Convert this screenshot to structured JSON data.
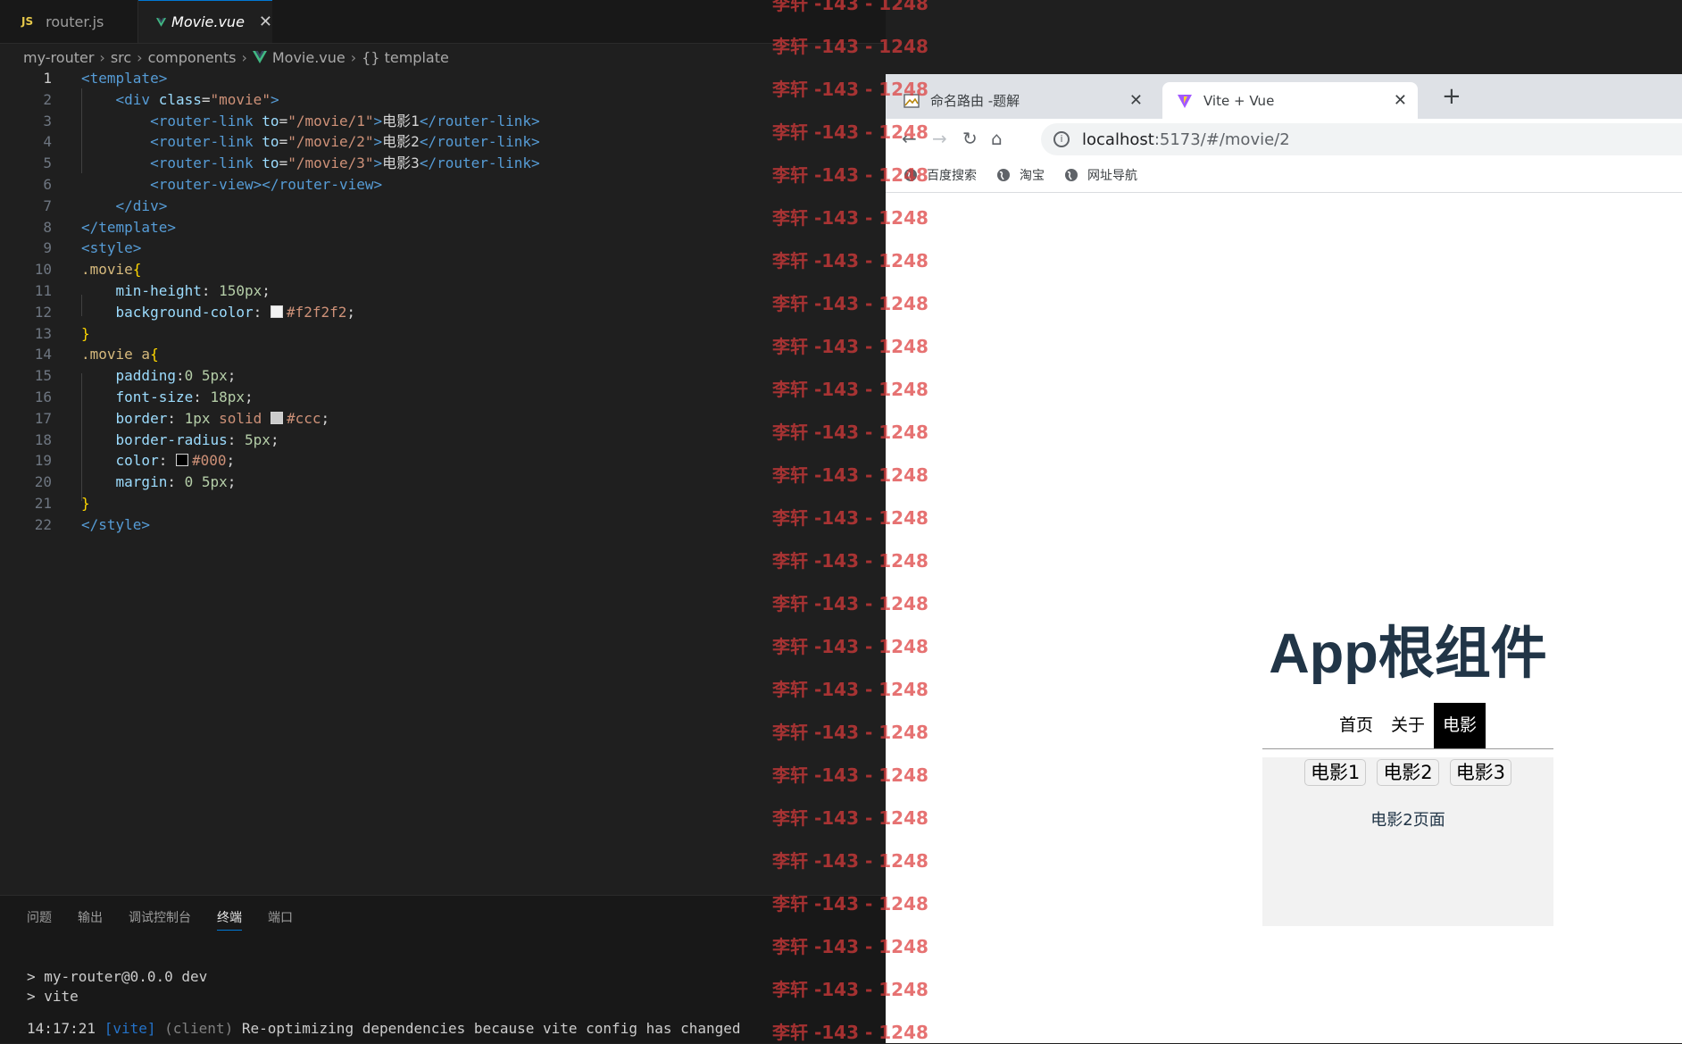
{
  "editor": {
    "tabs": [
      {
        "icon": "JS",
        "label": "router.js"
      },
      {
        "label": "Movie.vue"
      }
    ],
    "breadcrumb": [
      "my-router",
      "src",
      "components",
      "Movie.vue",
      "{} template"
    ],
    "lines": [
      {
        "n": "1",
        "html": "<span class=\"tag\">&lt;template&gt;</span>"
      },
      {
        "n": "2",
        "html": "    <span class=\"tag\">&lt;div</span> <span class=\"attr\">class</span>=<span class=\"str\">\"movie\"</span><span class=\"tag\">&gt;</span>"
      },
      {
        "n": "3",
        "html": "        <span class=\"tag\">&lt;router-link</span> <span class=\"attr\">to</span>=<span class=\"str\">\"/movie/1\"</span><span class=\"tag\">&gt;</span>电影1<span class=\"tag\">&lt;/router-link&gt;</span>"
      },
      {
        "n": "4",
        "html": "        <span class=\"tag\">&lt;router-link</span> <span class=\"attr\">to</span>=<span class=\"str\">\"/movie/2\"</span><span class=\"tag\">&gt;</span>电影2<span class=\"tag\">&lt;/router-link&gt;</span>"
      },
      {
        "n": "5",
        "html": "        <span class=\"tag\">&lt;router-link</span> <span class=\"attr\">to</span>=<span class=\"str\">\"/movie/3\"</span><span class=\"tag\">&gt;</span>电影3<span class=\"tag\">&lt;/router-link&gt;</span>"
      },
      {
        "n": "6",
        "html": "        <span class=\"tag\">&lt;router-view&gt;&lt;/router-view&gt;</span>"
      },
      {
        "n": "7",
        "html": "    <span class=\"tag\">&lt;/div&gt;</span>"
      },
      {
        "n": "8",
        "html": "<span class=\"tag\">&lt;/template&gt;</span>"
      },
      {
        "n": "9",
        "html": "<span class=\"tag\">&lt;style&gt;</span>"
      },
      {
        "n": "10",
        "html": "<span class=\"sel\">.movie</span><span class=\"brace\">{</span>"
      },
      {
        "n": "11",
        "html": "    <span class=\"prop\">min-height</span>: <span class=\"num\">150px</span>;"
      },
      {
        "n": "12",
        "html": "    <span class=\"prop\">background-color</span>: <span class=\"sw\" style=\"background:#f2f2f2\"></span><span class=\"val\">#f2f2f2</span>;"
      },
      {
        "n": "13",
        "html": "<span class=\"brace\">}</span>"
      },
      {
        "n": "14",
        "html": "<span class=\"sel\">.movie a</span><span class=\"brace\">{</span>"
      },
      {
        "n": "15",
        "html": "    <span class=\"prop\">padding</span>:<span class=\"num\">0 5px</span>;"
      },
      {
        "n": "16",
        "html": "    <span class=\"prop\">font-size</span>: <span class=\"num\">18px</span>;"
      },
      {
        "n": "17",
        "html": "    <span class=\"prop\">border</span>: <span class=\"num\">1px</span> <span class=\"val\">solid</span> <span class=\"sw\" style=\"background:#cccccc\"></span><span class=\"val\">#ccc</span>;"
      },
      {
        "n": "18",
        "html": "    <span class=\"prop\">border-radius</span>: <span class=\"num\">5px</span>;"
      },
      {
        "n": "19",
        "html": "    <span class=\"prop\">color</span>: <span class=\"sw\" style=\"background:#000000\"></span><span class=\"val\">#000</span>;"
      },
      {
        "n": "20",
        "html": "    <span class=\"prop\">margin</span>: <span class=\"num\">0 5px</span>;"
      },
      {
        "n": "21",
        "html": "<span class=\"brace\">}</span>"
      },
      {
        "n": "22",
        "html": "<span class=\"tag\">&lt;/style&gt;</span>"
      }
    ]
  },
  "panel": {
    "tabs": [
      "问题",
      "输出",
      "调试控制台",
      "终端",
      "端口"
    ],
    "active_tab": "终端",
    "terminal_lines": [
      "> my-router@0.0.0 dev",
      "> vite"
    ],
    "log": {
      "time": "14:17:21",
      "tag": "[vite]",
      "scope": "(client)",
      "message": "Re-optimizing dependencies because vite config has changed"
    }
  },
  "browser": {
    "tabs": [
      {
        "title": "命名路由 -题解",
        "icon": "image-icon"
      },
      {
        "title": "Vite + Vue",
        "icon": "vite-icon"
      }
    ],
    "url_host": "localhost",
    "url_rest": ":5173/#/movie/2",
    "bookmarks": [
      "百度搜索",
      "淘宝",
      "网址导航"
    ]
  },
  "app": {
    "title": "App根组件",
    "nav": [
      "首页",
      "关于",
      "电影"
    ],
    "active_nav": "电影",
    "movie_links": [
      "电影1",
      "电影2",
      "电影3"
    ],
    "view_text": "电影2页面"
  },
  "watermark": {
    "text": "李轩 -143 - 1248"
  },
  "colors": {
    "editor_bg": "#1f1f1f",
    "accent": "#0078d4",
    "app_title": "#213547",
    "movie_bg": "#f2f2f2",
    "watermark": "#dc3c3c"
  }
}
